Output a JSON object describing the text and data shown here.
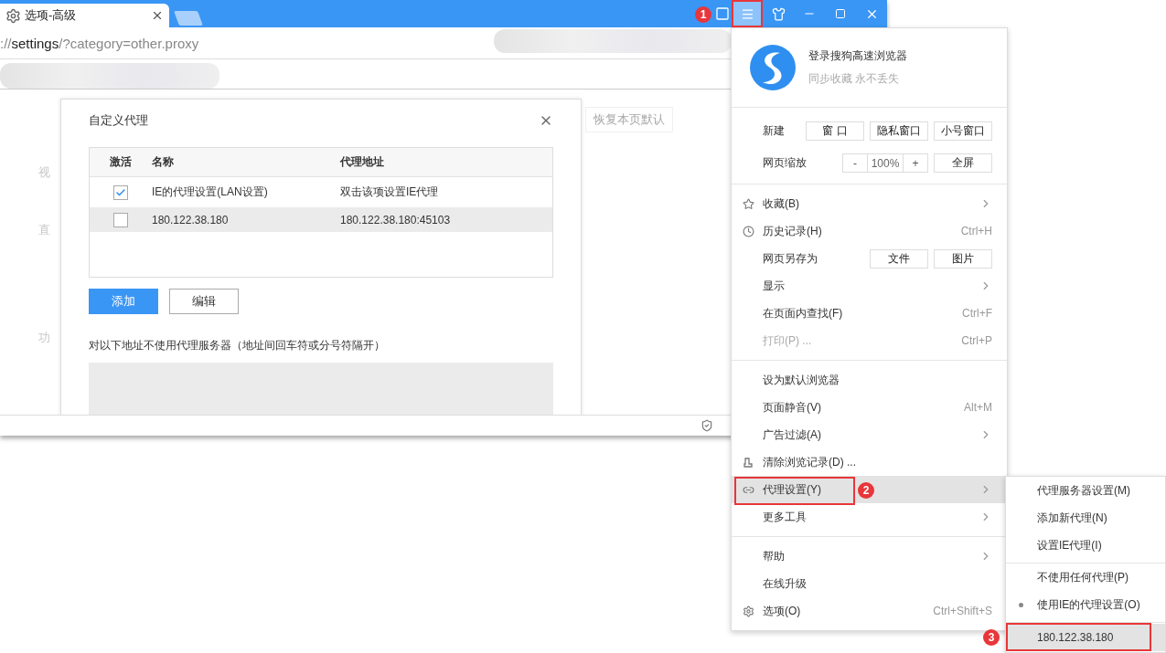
{
  "browser": {
    "tab": {
      "title": "选项-高级",
      "selected": true
    },
    "address": {
      "scheme": "://",
      "host": "settings",
      "path": "/?category=other.proxy"
    },
    "page": {
      "side_labels": [
        "视",
        "直",
        "功"
      ],
      "restore_button": "恢复本页默认"
    }
  },
  "dialog": {
    "title": "自定义代理",
    "columns": [
      "激活",
      "名称",
      "代理地址"
    ],
    "rows": [
      {
        "checked": true,
        "selected": false,
        "name": "IE的代理设置(LAN设置)",
        "address": "双击该项设置IE代理"
      },
      {
        "checked": false,
        "selected": true,
        "name": "180.122.38.180",
        "address": "180.122.38.180:45103"
      }
    ],
    "buttons": [
      {
        "label": "添加",
        "kind": "primary"
      },
      {
        "label": "编辑",
        "kind": "default"
      }
    ],
    "exclusion_label": "对以下地址不使用代理服务器（地址间回车符或分号符隔开）"
  },
  "menu": {
    "account": {
      "title": "登录搜狗高速浏览器",
      "subtitle": "同步收藏 永不丢失"
    },
    "new_row": {
      "label": "新建",
      "buttons": [
        "窗 口",
        "隐私窗口",
        "小号窗口"
      ]
    },
    "zoom_row": {
      "label": "网页缩放",
      "minus": "-",
      "value": "100%",
      "plus": "+",
      "fullscreen": "全屏"
    },
    "sections": [
      [
        {
          "kind": "item",
          "label": "收藏(B)",
          "submenu": true,
          "disabled": false,
          "highlighted": false
        },
        {
          "kind": "item",
          "label": "历史记录(H)",
          "shortcut": "Ctrl+H",
          "submenu": false,
          "disabled": false,
          "highlighted": false
        },
        {
          "kind": "buttons",
          "label": "网页另存为",
          "buttons": [
            "文件",
            "图片"
          ],
          "submenu": false,
          "disabled": false,
          "highlighted": false
        },
        {
          "kind": "item",
          "label": "显示",
          "submenu": true,
          "disabled": false,
          "highlighted": false
        },
        {
          "kind": "item",
          "label": "在页面内查找(F)",
          "shortcut": "Ctrl+F",
          "submenu": false,
          "disabled": false,
          "highlighted": false
        },
        {
          "kind": "item",
          "label": "打印(P) ...",
          "shortcut": "Ctrl+P",
          "submenu": false,
          "disabled": true,
          "highlighted": false
        }
      ],
      [
        {
          "kind": "item",
          "label": "设为默认浏览器",
          "submenu": false,
          "disabled": false,
          "highlighted": false
        },
        {
          "kind": "item",
          "label": "页面静音(V)",
          "shortcut": "Alt+M",
          "submenu": false,
          "disabled": false,
          "highlighted": false
        },
        {
          "kind": "item",
          "label": "广告过滤(A)",
          "submenu": true,
          "disabled": false,
          "highlighted": false
        },
        {
          "kind": "item",
          "label": "清除浏览记录(D) ...",
          "submenu": false,
          "disabled": false,
          "highlighted": false
        },
        {
          "kind": "item",
          "label": "代理设置(Y)",
          "submenu": true,
          "disabled": false,
          "highlighted": true
        },
        {
          "kind": "item",
          "label": "更多工具",
          "submenu": true,
          "disabled": false,
          "highlighted": false
        }
      ],
      [
        {
          "kind": "item",
          "label": "帮助",
          "submenu": true,
          "disabled": false,
          "highlighted": false
        },
        {
          "kind": "item",
          "label": "在线升级",
          "submenu": false,
          "disabled": false,
          "highlighted": false
        },
        {
          "kind": "item",
          "label": "选项(O)",
          "shortcut": "Ctrl+Shift+S",
          "submenu": false,
          "disabled": false,
          "highlighted": false
        }
      ]
    ]
  },
  "submenu": {
    "sections": [
      [
        {
          "label": "代理服务器设置(M)",
          "checked": false,
          "highlighted": false
        },
        {
          "label": "添加新代理(N)",
          "checked": false,
          "highlighted": false
        },
        {
          "label": "设置IE代理(I)",
          "checked": false,
          "highlighted": false
        }
      ],
      [
        {
          "label": "不使用任何代理(P)",
          "checked": false,
          "highlighted": false
        },
        {
          "label": "使用IE的代理设置(O)",
          "checked": true,
          "highlighted": false
        }
      ],
      [
        {
          "label": "180.122.38.180",
          "checked": false,
          "highlighted": true
        }
      ]
    ]
  },
  "annotations": [
    {
      "number": "1"
    },
    {
      "number": "2"
    },
    {
      "number": "3"
    }
  ]
}
